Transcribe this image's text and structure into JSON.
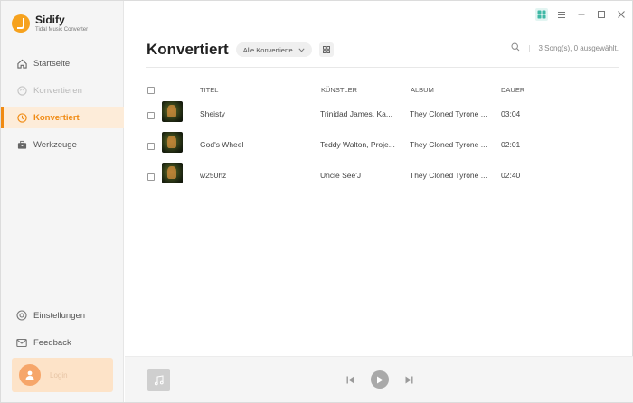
{
  "app": {
    "name": "Sidify",
    "subtitle": "Tidal Music Converter"
  },
  "sidebar": {
    "items": [
      {
        "label": "Startseite",
        "icon": "home-icon",
        "state": "normal"
      },
      {
        "label": "Konvertieren",
        "icon": "convert-icon",
        "state": "disabled"
      },
      {
        "label": "Konvertiert",
        "icon": "clock-icon",
        "state": "active"
      },
      {
        "label": "Werkzeuge",
        "icon": "toolbox-icon",
        "state": "normal"
      }
    ],
    "bottom_items": [
      {
        "label": "Einstellungen",
        "icon": "gear-icon"
      },
      {
        "label": "Feedback",
        "icon": "mail-icon"
      }
    ],
    "user_label": "Login"
  },
  "main": {
    "title": "Konvertiert",
    "filter_label": "Alle Konvertierte",
    "song_status": "3 Song(s), 0 ausgewählt."
  },
  "table": {
    "columns": [
      "TITEL",
      "KÜNSTLER",
      "ALBUM",
      "DAUER"
    ],
    "rows": [
      {
        "title": "Sheisty",
        "artist": "Trinidad James, Ka...",
        "album": "They Cloned Tyrone ...",
        "duration": "03:04"
      },
      {
        "title": "God's Wheel",
        "artist": "Teddy Walton, Proje...",
        "album": "They Cloned Tyrone ...",
        "duration": "02:01"
      },
      {
        "title": "w250hz",
        "artist": "Uncle See'J",
        "album": "They Cloned Tyrone ...",
        "duration": "02:40"
      }
    ]
  },
  "colors": {
    "accent": "#f08a12",
    "active_bg": "#fdecd9",
    "titlebar_active": "#3fb8a5"
  }
}
